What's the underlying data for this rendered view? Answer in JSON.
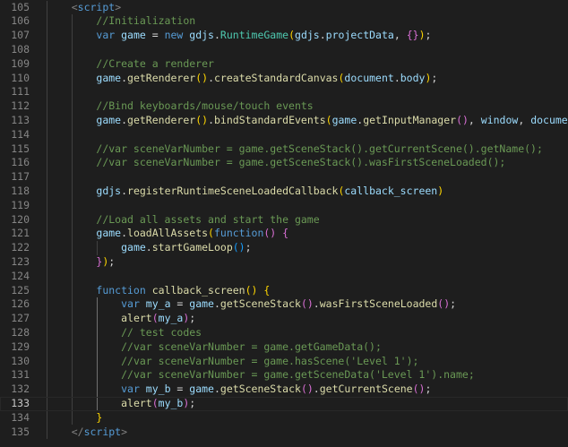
{
  "editor": {
    "theme": {
      "background": "#1e1e1e",
      "line_number": "#858585",
      "line_number_active": "#c6c6c6"
    },
    "active_line": 133,
    "lines": [
      {
        "n": "105",
        "tokens": [
          [
            "t-pun",
            "    "
          ],
          [
            "t-tag",
            "<"
          ],
          [
            "t-tagname",
            "script"
          ],
          [
            "t-tag",
            ">"
          ]
        ]
      },
      {
        "n": "106",
        "tokens": [
          [
            "t-pun",
            "        "
          ],
          [
            "t-comment",
            "//Initialization"
          ]
        ]
      },
      {
        "n": "107",
        "tokens": [
          [
            "t-pun",
            "        "
          ],
          [
            "t-kw",
            "var "
          ],
          [
            "t-var",
            "game"
          ],
          [
            "t-pun",
            " = "
          ],
          [
            "t-kw",
            "new "
          ],
          [
            "t-var",
            "gdjs"
          ],
          [
            "t-pun",
            "."
          ],
          [
            "t-cls",
            "RuntimeGame"
          ],
          [
            "t-b1",
            "("
          ],
          [
            "t-var",
            "gdjs"
          ],
          [
            "t-pun",
            "."
          ],
          [
            "t-var",
            "projectData"
          ],
          [
            "t-pun",
            ", "
          ],
          [
            "t-b2",
            "{}"
          ],
          [
            "t-b1",
            ")"
          ],
          [
            "t-pun",
            ";"
          ]
        ]
      },
      {
        "n": "108",
        "tokens": []
      },
      {
        "n": "109",
        "tokens": [
          [
            "t-pun",
            "        "
          ],
          [
            "t-comment",
            "//Create a renderer"
          ]
        ]
      },
      {
        "n": "110",
        "tokens": [
          [
            "t-pun",
            "        "
          ],
          [
            "t-var",
            "game"
          ],
          [
            "t-pun",
            "."
          ],
          [
            "t-fn",
            "getRenderer"
          ],
          [
            "t-b1",
            "()"
          ],
          [
            "t-pun",
            "."
          ],
          [
            "t-fn",
            "createStandardCanvas"
          ],
          [
            "t-b1",
            "("
          ],
          [
            "t-var",
            "document"
          ],
          [
            "t-pun",
            "."
          ],
          [
            "t-var",
            "body"
          ],
          [
            "t-b1",
            ")"
          ],
          [
            "t-pun",
            ";"
          ]
        ]
      },
      {
        "n": "111",
        "tokens": []
      },
      {
        "n": "112",
        "tokens": [
          [
            "t-pun",
            "        "
          ],
          [
            "t-comment",
            "//Bind keyboards/mouse/touch events"
          ]
        ]
      },
      {
        "n": "113",
        "tokens": [
          [
            "t-pun",
            "        "
          ],
          [
            "t-var",
            "game"
          ],
          [
            "t-pun",
            "."
          ],
          [
            "t-fn",
            "getRenderer"
          ],
          [
            "t-b1",
            "()"
          ],
          [
            "t-pun",
            "."
          ],
          [
            "t-fn",
            "bindStandardEvents"
          ],
          [
            "t-b1",
            "("
          ],
          [
            "t-var",
            "game"
          ],
          [
            "t-pun",
            "."
          ],
          [
            "t-fn",
            "getInputManager"
          ],
          [
            "t-b2",
            "()"
          ],
          [
            "t-pun",
            ", "
          ],
          [
            "t-var",
            "window"
          ],
          [
            "t-pun",
            ", "
          ],
          [
            "t-var",
            "document"
          ],
          [
            "t-b1",
            ")"
          ],
          [
            "t-pun",
            ";"
          ]
        ]
      },
      {
        "n": "114",
        "tokens": []
      },
      {
        "n": "115",
        "tokens": [
          [
            "t-pun",
            "        "
          ],
          [
            "t-comment",
            "//var sceneVarNumber = game.getSceneStack().getCurrentScene().getName();"
          ]
        ]
      },
      {
        "n": "116",
        "tokens": [
          [
            "t-pun",
            "        "
          ],
          [
            "t-comment",
            "//var sceneVarNumber = game.getSceneStack().wasFirstSceneLoaded();"
          ]
        ]
      },
      {
        "n": "117",
        "tokens": []
      },
      {
        "n": "118",
        "tokens": [
          [
            "t-pun",
            "        "
          ],
          [
            "t-var",
            "gdjs"
          ],
          [
            "t-pun",
            "."
          ],
          [
            "t-fn",
            "registerRuntimeSceneLoadedCallback"
          ],
          [
            "t-b1",
            "("
          ],
          [
            "t-var",
            "callback_screen"
          ],
          [
            "t-b1",
            ")"
          ]
        ]
      },
      {
        "n": "119",
        "tokens": []
      },
      {
        "n": "120",
        "tokens": [
          [
            "t-pun",
            "        "
          ],
          [
            "t-comment",
            "//Load all assets and start the game"
          ]
        ]
      },
      {
        "n": "121",
        "tokens": [
          [
            "t-pun",
            "        "
          ],
          [
            "t-var",
            "game"
          ],
          [
            "t-pun",
            "."
          ],
          [
            "t-fn",
            "loadAllAssets"
          ],
          [
            "t-b1",
            "("
          ],
          [
            "t-kw",
            "function"
          ],
          [
            "t-b2",
            "()"
          ],
          [
            "t-pun",
            " "
          ],
          [
            "t-b2",
            "{"
          ]
        ]
      },
      {
        "n": "122",
        "tokens": [
          [
            "t-pun",
            "            "
          ],
          [
            "t-var",
            "game"
          ],
          [
            "t-pun",
            "."
          ],
          [
            "t-fn",
            "startGameLoop"
          ],
          [
            "t-b3",
            "()"
          ],
          [
            "t-pun",
            ";"
          ]
        ]
      },
      {
        "n": "123",
        "tokens": [
          [
            "t-pun",
            "        "
          ],
          [
            "t-b2",
            "}"
          ],
          [
            "t-b1",
            ")"
          ],
          [
            "t-pun",
            ";"
          ]
        ]
      },
      {
        "n": "124",
        "tokens": []
      },
      {
        "n": "125",
        "tokens": [
          [
            "t-pun",
            "        "
          ],
          [
            "t-kw",
            "function "
          ],
          [
            "t-fn",
            "callback_screen"
          ],
          [
            "t-b1",
            "()"
          ],
          [
            "t-pun",
            " "
          ],
          [
            "t-b1",
            "{"
          ]
        ]
      },
      {
        "n": "126",
        "tokens": [
          [
            "t-pun",
            "            "
          ],
          [
            "t-kw",
            "var "
          ],
          [
            "t-var",
            "my_a"
          ],
          [
            "t-pun",
            " = "
          ],
          [
            "t-var",
            "game"
          ],
          [
            "t-pun",
            "."
          ],
          [
            "t-fn",
            "getSceneStack"
          ],
          [
            "t-b2",
            "()"
          ],
          [
            "t-pun",
            "."
          ],
          [
            "t-fn",
            "wasFirstSceneLoaded"
          ],
          [
            "t-b2",
            "()"
          ],
          [
            "t-pun",
            ";"
          ]
        ]
      },
      {
        "n": "127",
        "tokens": [
          [
            "t-pun",
            "            "
          ],
          [
            "t-fn",
            "alert"
          ],
          [
            "t-b2",
            "("
          ],
          [
            "t-var",
            "my_a"
          ],
          [
            "t-b2",
            ")"
          ],
          [
            "t-pun",
            ";"
          ]
        ]
      },
      {
        "n": "128",
        "tokens": [
          [
            "t-pun",
            "            "
          ],
          [
            "t-comment",
            "// test codes"
          ]
        ]
      },
      {
        "n": "129",
        "tokens": [
          [
            "t-pun",
            "            "
          ],
          [
            "t-comment",
            "//var sceneVarNumber = game.getGameData();"
          ]
        ]
      },
      {
        "n": "130",
        "tokens": [
          [
            "t-pun",
            "            "
          ],
          [
            "t-comment",
            "//var sceneVarNumber = game.hasScene('Level 1');"
          ]
        ]
      },
      {
        "n": "131",
        "tokens": [
          [
            "t-pun",
            "            "
          ],
          [
            "t-comment",
            "//var sceneVarNumber = game.getSceneData('Level 1').name;"
          ]
        ]
      },
      {
        "n": "132",
        "tokens": [
          [
            "t-pun",
            "            "
          ],
          [
            "t-kw",
            "var "
          ],
          [
            "t-var",
            "my_b"
          ],
          [
            "t-pun",
            " = "
          ],
          [
            "t-var",
            "game"
          ],
          [
            "t-pun",
            "."
          ],
          [
            "t-fn",
            "getSceneStack"
          ],
          [
            "t-b2",
            "()"
          ],
          [
            "t-pun",
            "."
          ],
          [
            "t-fn",
            "getCurrentScene"
          ],
          [
            "t-b2",
            "()"
          ],
          [
            "t-pun",
            ";"
          ]
        ]
      },
      {
        "n": "133",
        "tokens": [
          [
            "t-pun",
            "            "
          ],
          [
            "t-fn",
            "alert"
          ],
          [
            "t-b2",
            "("
          ],
          [
            "t-var",
            "my_b"
          ],
          [
            "t-b2",
            ")"
          ],
          [
            "t-pun",
            ";"
          ]
        ]
      },
      {
        "n": "134",
        "tokens": [
          [
            "t-pun",
            "        "
          ],
          [
            "t-b1",
            "}"
          ]
        ]
      },
      {
        "n": "135",
        "tokens": [
          [
            "t-pun",
            "    "
          ],
          [
            "t-tag",
            "</"
          ],
          [
            "t-tagname",
            "script"
          ],
          [
            "t-tag",
            ">"
          ]
        ]
      }
    ]
  }
}
